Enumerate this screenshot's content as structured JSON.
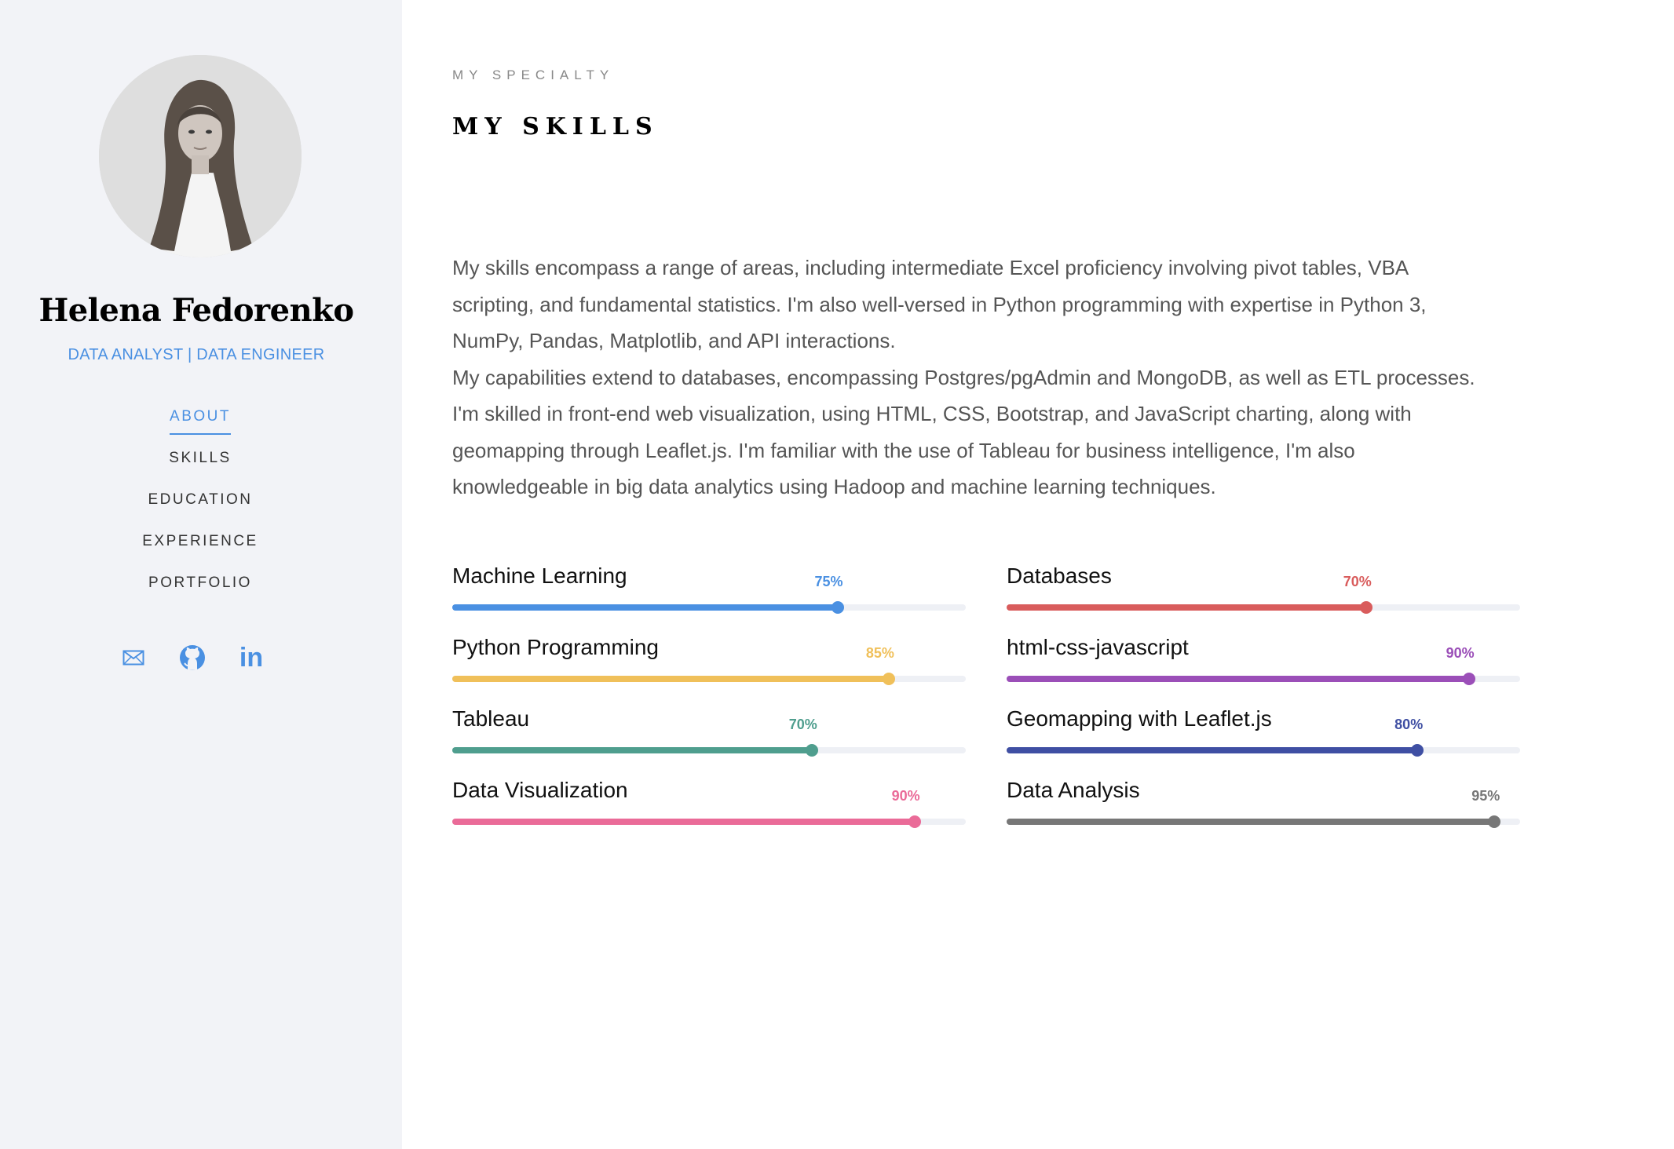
{
  "profile": {
    "name": "Helena Fedorenko",
    "role": "DATA ANALYST | DATA ENGINEER",
    "accent": "#4a90e2"
  },
  "nav": {
    "items": [
      {
        "label": "ABOUT",
        "active": true
      },
      {
        "label": "SKILLS",
        "active": false
      },
      {
        "label": "EDUCATION",
        "active": false
      },
      {
        "label": "EXPERIENCE",
        "active": false
      },
      {
        "label": "PORTFOLIO",
        "active": false
      }
    ]
  },
  "socials": [
    {
      "icon": "mail-icon"
    },
    {
      "icon": "github-icon"
    },
    {
      "icon": "linkedin-icon",
      "text": "in"
    }
  ],
  "section": {
    "eyebrow": "MY SPECIALTY",
    "title": "MY SKILLS",
    "intro_lines": [
      "My skills encompass a range of areas, including intermediate Excel proficiency involving pivot tables, VBA",
      "scripting, and fundamental statistics. I'm also well-versed in Python programming with expertise in Python 3,",
      "NumPy, Pandas, Matplotlib, and API interactions.",
      "My capabilities extend to databases, encompassing Postgres/pgAdmin and MongoDB, as well as ETL processes.",
      "I'm skilled in front-end web visualization, using HTML, CSS, Bootstrap, and JavaScript charting, along with",
      "geomapping through Leaflet.js. I'm familiar with the use of Tableau for business intelligence, I'm also",
      "knowledgeable in big data analytics using Hadoop and machine learning techniques."
    ]
  },
  "skills": [
    {
      "name": "Machine Learning",
      "value": 75,
      "label": "75%",
      "color": "#4a90e2"
    },
    {
      "name": "Databases",
      "value": 70,
      "label": "70%",
      "color": "#d95c5c"
    },
    {
      "name": "Python Programming",
      "value": 85,
      "label": "85%",
      "color": "#f0c05a"
    },
    {
      "name": "html-css-javascript",
      "value": 90,
      "label": "90%",
      "color": "#9b4fb8"
    },
    {
      "name": "Tableau",
      "value": 70,
      "label": "70%",
      "color": "#4f9e8e"
    },
    {
      "name": "Geomapping with Leaflet.js",
      "value": 80,
      "label": "80%",
      "color": "#3f4fa3"
    },
    {
      "name": "Data Visualization",
      "value": 90,
      "label": "90%",
      "color": "#ea6b98"
    },
    {
      "name": "Data Analysis",
      "value": 95,
      "label": "95%",
      "color": "#777777"
    }
  ]
}
